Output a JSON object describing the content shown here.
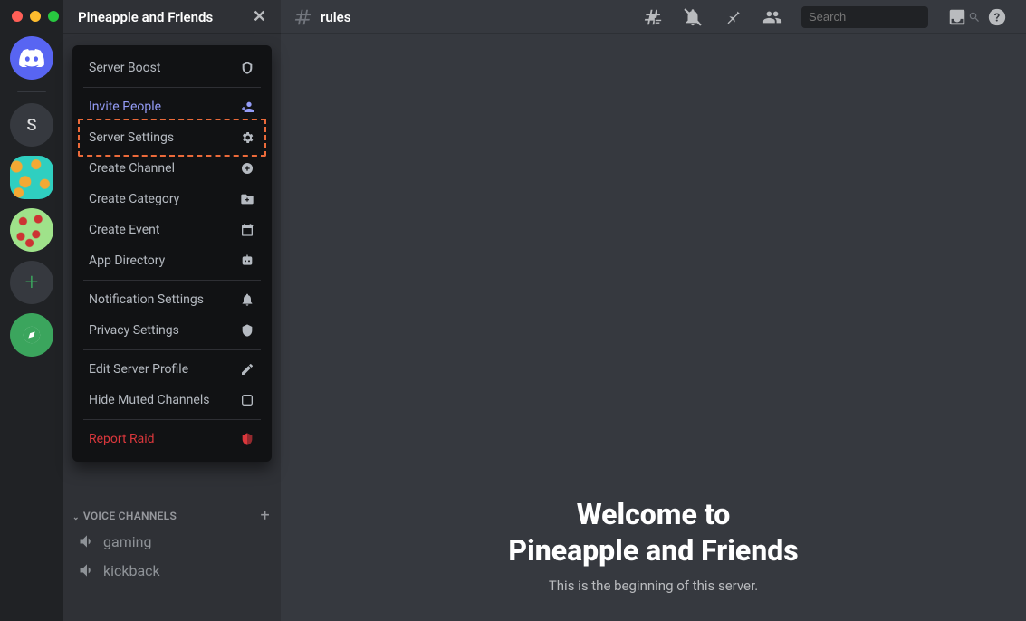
{
  "server": {
    "name": "Pineapple and Friends"
  },
  "channel": {
    "name": "rules"
  },
  "search": {
    "placeholder": "Search"
  },
  "welcome": {
    "line1": "Welcome to",
    "line2": "Pineapple and Friends",
    "sub": "This is the beginning of this server."
  },
  "guilds": {
    "letter": "S"
  },
  "menu": {
    "server_boost": "Server Boost",
    "invite_people": "Invite People",
    "server_settings": "Server Settings",
    "create_channel": "Create Channel",
    "create_category": "Create Category",
    "create_event": "Create Event",
    "app_directory": "App Directory",
    "notification_settings": "Notification Settings",
    "privacy_settings": "Privacy Settings",
    "edit_server_profile": "Edit Server Profile",
    "hide_muted": "Hide Muted Channels",
    "report_raid": "Report Raid"
  },
  "categories": {
    "voice_label": "VOICE CHANNELS",
    "voice": [
      {
        "name": "gaming"
      },
      {
        "name": "kickback"
      }
    ]
  }
}
